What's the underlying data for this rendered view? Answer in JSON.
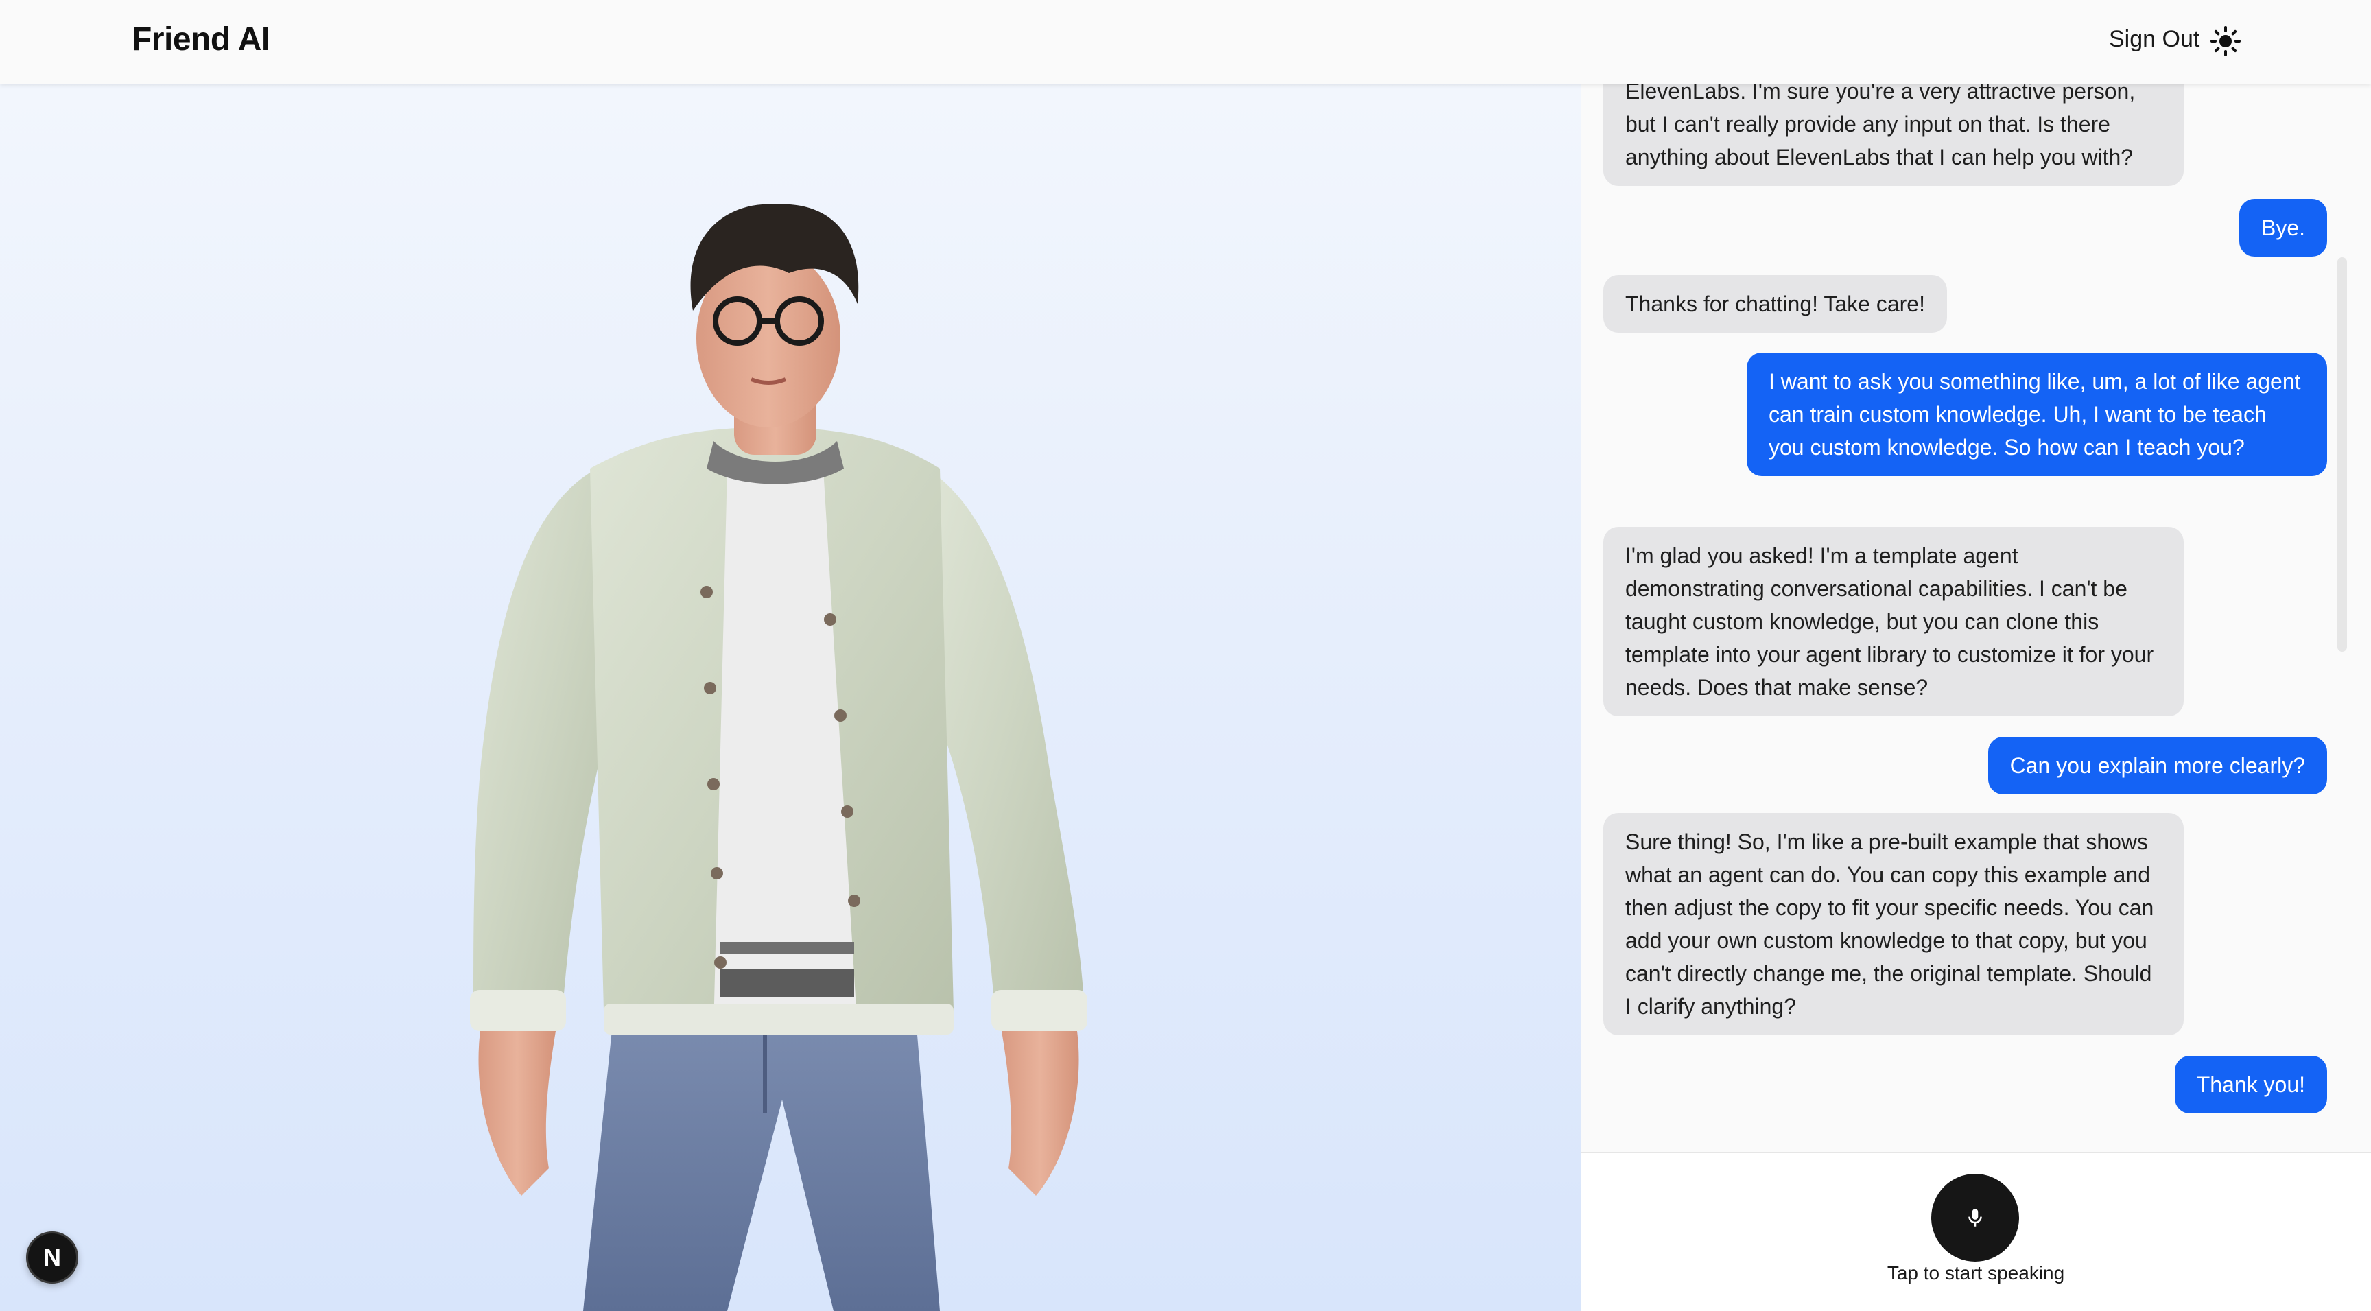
{
  "header": {
    "brand": "Friend AI",
    "sign_out_label": "Sign Out",
    "theme_icon": "sun-icon"
  },
  "badge": {
    "letter": "N"
  },
  "chat": {
    "messages": [
      {
        "role": "bot",
        "text": "ElevenLabs. I'm sure you're a very attractive person, but I can't really provide any input on that. Is there anything about ElevenLabs that I can help you with?"
      },
      {
        "role": "user",
        "text": "Bye."
      },
      {
        "role": "bot",
        "text": "Thanks for chatting! Take care!"
      },
      {
        "role": "user",
        "text": "I want to ask you something like, um, a lot of like agent can train custom knowledge. Uh, I want to be teach you custom knowledge. So how can I teach you?"
      },
      {
        "role": "bot",
        "text": "I'm glad you asked! I'm a template agent demonstrating conversational capabilities. I can't be taught custom knowledge, but you can clone this template into your agent library to customize it for your needs. Does that make sense?"
      },
      {
        "role": "user",
        "text": "Can you explain more clearly?"
      },
      {
        "role": "bot",
        "text": "Sure thing! So, I'm like a pre-built example that shows what an agent can do. You can copy this example and then adjust the copy to fit your specific needs. You can add your own custom knowledge to that copy, but you can't directly change me, the original template. Should I clarify anything?"
      },
      {
        "role": "user",
        "text": "Thank you!"
      }
    ]
  },
  "mic": {
    "icon": "microphone-icon",
    "hint": "Tap to start speaking"
  },
  "colors": {
    "accent": "#1463f5",
    "bot_bubble": "#e5e5e7",
    "mic_button": "#161616"
  }
}
